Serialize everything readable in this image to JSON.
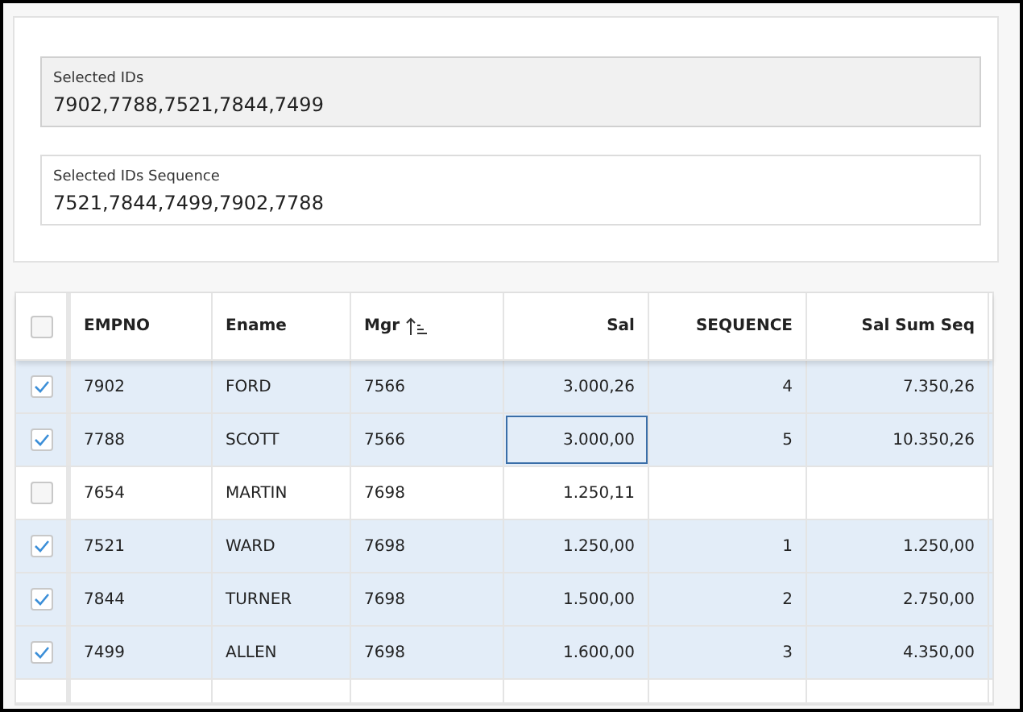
{
  "fields": [
    {
      "label": "Selected IDs",
      "value": "7902,7788,7521,7844,7499",
      "readonly": true
    },
    {
      "label": "Selected IDs Sequence",
      "value": "7521,7844,7499,7902,7788",
      "readonly": false
    }
  ],
  "table": {
    "all_selected": false,
    "columns": [
      {
        "label": "EMPNO",
        "right_aligned": false,
        "sort_ascending": false
      },
      {
        "label": "Ename",
        "right_aligned": false,
        "sort_ascending": false
      },
      {
        "label": "Mgr",
        "right_aligned": false,
        "sort_ascending": true
      },
      {
        "label": "Sal",
        "right_aligned": true,
        "sort_ascending": false
      },
      {
        "label": "SEQUENCE",
        "right_aligned": true,
        "sort_ascending": false
      },
      {
        "label": "Sal Sum Seq",
        "right_aligned": true,
        "sort_ascending": false
      }
    ],
    "rows": [
      {
        "selected": true,
        "sal_focused": false,
        "cells": [
          "7902",
          "FORD",
          "7566",
          "3.000,26",
          "4",
          "7.350,26"
        ]
      },
      {
        "selected": true,
        "sal_focused": true,
        "cells": [
          "7788",
          "SCOTT",
          "7566",
          "3.000,00",
          "5",
          "10.350,26"
        ]
      },
      {
        "selected": false,
        "sal_focused": false,
        "cells": [
          "7654",
          "MARTIN",
          "7698",
          "1.250,11",
          "",
          ""
        ]
      },
      {
        "selected": true,
        "sal_focused": false,
        "cells": [
          "7521",
          "WARD",
          "7698",
          "1.250,00",
          "1",
          "1.250,00"
        ]
      },
      {
        "selected": true,
        "sal_focused": false,
        "cells": [
          "7844",
          "TURNER",
          "7698",
          "1.500,00",
          "2",
          "2.750,00"
        ]
      },
      {
        "selected": true,
        "sal_focused": false,
        "cells": [
          "7499",
          "ALLEN",
          "7698",
          "1.600,00",
          "3",
          "4.350,00"
        ]
      }
    ]
  }
}
